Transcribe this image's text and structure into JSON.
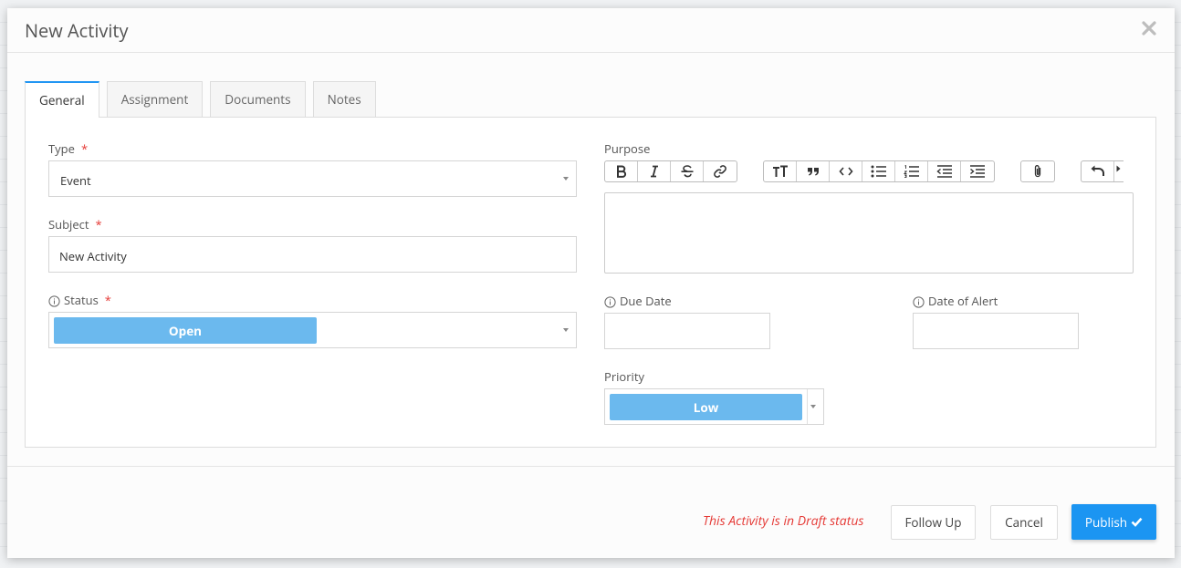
{
  "modal": {
    "title": "New Activity",
    "close_icon": "close-icon"
  },
  "tabs": [
    {
      "label": "General",
      "active": true
    },
    {
      "label": "Assignment",
      "active": false
    },
    {
      "label": "Documents",
      "active": false
    },
    {
      "label": "Notes",
      "active": false
    }
  ],
  "form": {
    "type": {
      "label": "Type",
      "required_mark": "*",
      "value": "Event"
    },
    "subject": {
      "label": "Subject",
      "required_mark": "*",
      "value": "New Activity"
    },
    "status": {
      "label": "Status",
      "required_mark": "*",
      "value": "Open"
    },
    "purpose": {
      "label": "Purpose",
      "value": ""
    },
    "due_date": {
      "label": "Due Date",
      "value": ""
    },
    "date_of_alert": {
      "label": "Date of Alert",
      "value": ""
    },
    "priority": {
      "label": "Priority",
      "value": "Low"
    }
  },
  "toolbar_icons": [
    [
      "bold-icon",
      "italic-icon",
      "strikethrough-icon",
      "link-icon"
    ],
    [
      "heading-icon",
      "quote-icon",
      "code-icon",
      "bullet-list-icon",
      "numbered-list-icon",
      "outdent-icon",
      "indent-icon"
    ],
    [
      "attach-icon"
    ],
    [
      "undo-icon",
      "redo-icon"
    ]
  ],
  "footer": {
    "draft_message": "This Activity is in Draft status",
    "follow_up_label": "Follow Up",
    "cancel_label": "Cancel",
    "publish_label": "Publish"
  },
  "colors": {
    "accent": "#1b95f2",
    "pill": "#6bb9ee",
    "required": "#e53935"
  }
}
